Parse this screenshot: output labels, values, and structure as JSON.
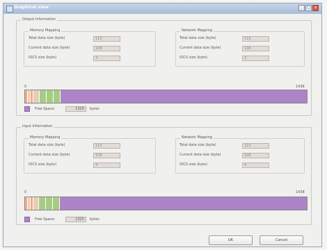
{
  "window": {
    "title": "Graphical view",
    "buttons": [
      "_",
      "□",
      "×"
    ]
  },
  "output": {
    "title": "Output Information",
    "memory": {
      "title": "Memory Mapping",
      "rows": [
        {
          "label": "Total data size  (byte)",
          "value": "115"
        },
        {
          "label": "Current data size  (byte)",
          "value": "108"
        },
        {
          "label": "IOCS size  (byte)",
          "value": "3"
        }
      ]
    },
    "network": {
      "title": "Network Mapping",
      "rows": [
        {
          "label": "Total data size  (byte)",
          "value": "115"
        },
        {
          "label": "Current data size  (byte)",
          "value": "108"
        },
        {
          "label": "IOCS size  (byte)",
          "value": "3"
        }
      ]
    },
    "scale_min": "0",
    "scale_max": "1438",
    "free_space_label": "Free Space:",
    "free_space_value": "1325",
    "free_space_unit": "bytes"
  },
  "input": {
    "title": "Input Information",
    "memory": {
      "title": "Memory Mapping",
      "rows": [
        {
          "label": "Total data size  (byte)",
          "value": "115"
        },
        {
          "label": "Current data size  (byte)",
          "value": "108"
        },
        {
          "label": "IOCS size  (byte)",
          "value": "4"
        }
      ]
    },
    "network": {
      "title": "Network Mapping",
      "rows": [
        {
          "label": "Total data size  (byte)",
          "value": "115"
        },
        {
          "label": "Current data size  (byte)",
          "value": "108"
        },
        {
          "label": "IOCS size  (byte)",
          "value": "4"
        }
      ]
    },
    "scale_min": "0",
    "scale_max": "1438",
    "free_space_label": "Free Space:",
    "free_space_value": "1325",
    "free_space_unit": "bytes"
  },
  "colors": {
    "free": "#ad84c7",
    "used_green": "#a6cc84",
    "used_pink": "#f0a98b",
    "used_tan": "#e9ccb8"
  },
  "buttons": {
    "ok": "OK",
    "cancel": "Cancel"
  }
}
